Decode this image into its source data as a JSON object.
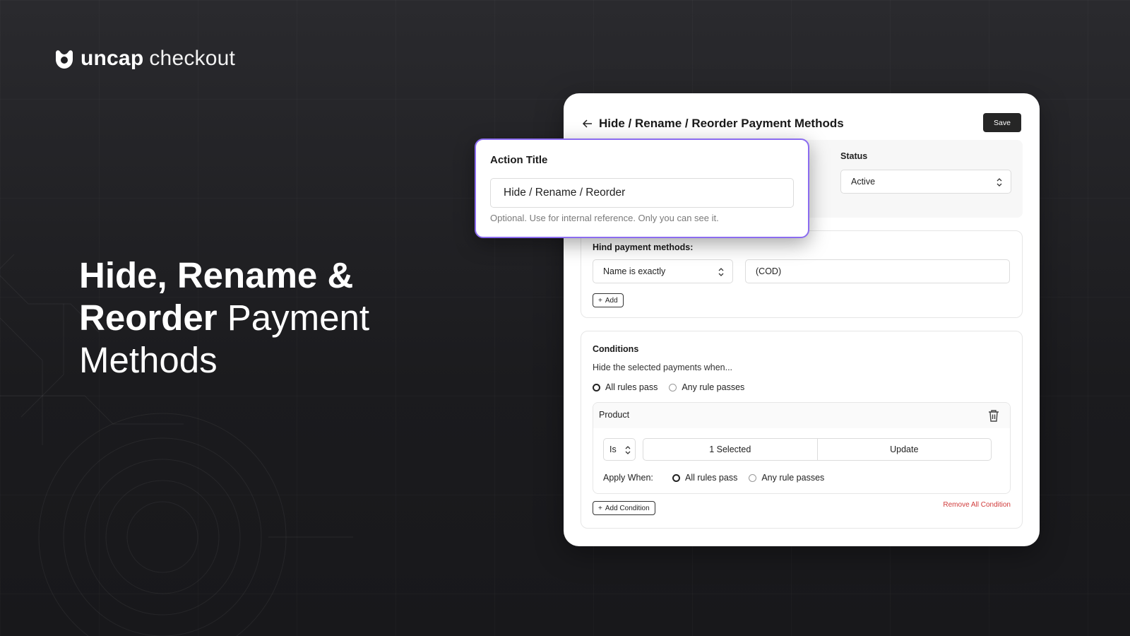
{
  "brand": {
    "name_bold": "uncap",
    "name_light": "checkout"
  },
  "hero": {
    "line1": "Hide, Rename &",
    "line2_bold": "Reorder",
    "line2_light": "Payment",
    "line3": "Methods"
  },
  "panel": {
    "title": "Hide / Rename / Reorder Payment Methods",
    "save_label": "Save",
    "status": {
      "label": "Status",
      "value": "Active"
    },
    "hide": {
      "label": "Hind payment methods:",
      "match_select": "Name is exactly",
      "match_value": "(COD)",
      "add_label": "Add"
    },
    "conditions": {
      "label": "Conditions",
      "subtitle": "Hide the selected payments when...",
      "mode_options": [
        "All rules pass",
        "Any rule passes"
      ],
      "mode_selected": "All rules pass",
      "rule": {
        "name": "Product",
        "operator": "Is",
        "selected_text": "1 Selected",
        "update_label": "Update",
        "apply_when_label": "Apply When:",
        "apply_options": [
          "All rules pass",
          "Any rule passes"
        ]
      },
      "add_condition_label": "Add Condition",
      "remove_all_label": "Remove All Condition"
    }
  },
  "popup": {
    "label": "Action Title",
    "value": "Hide / Rename / Reorder",
    "help": "Optional. Use for internal reference. Only you can see it."
  },
  "colors": {
    "accent_border": "#8b6cf0",
    "danger": "#d03a3a",
    "background": "#1d1d20"
  },
  "icons": [
    "logo-icon",
    "back-arrow-icon",
    "chevron-updown-icon",
    "plus-icon",
    "trash-icon"
  ]
}
